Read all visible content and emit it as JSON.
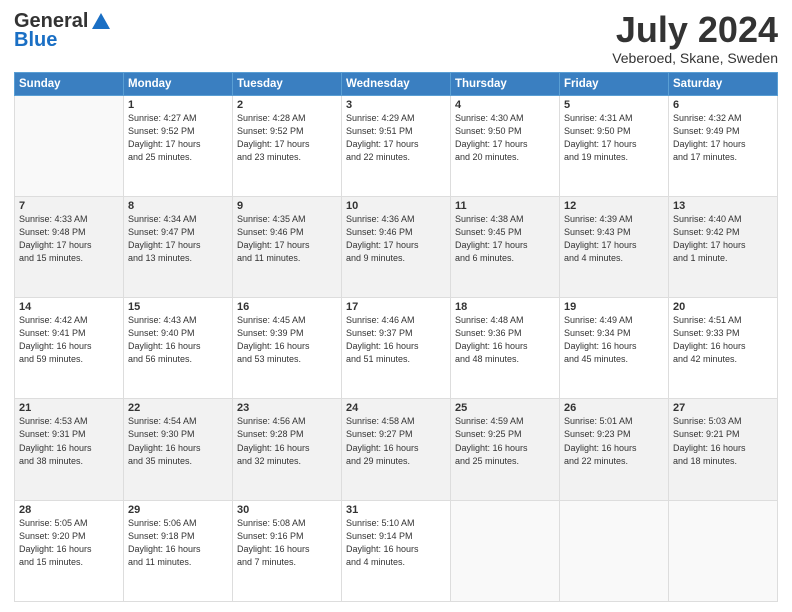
{
  "header": {
    "logo_general": "General",
    "logo_blue": "Blue",
    "month_title": "July 2024",
    "location": "Veberoed, Skane, Sweden"
  },
  "days_of_week": [
    "Sunday",
    "Monday",
    "Tuesday",
    "Wednesday",
    "Thursday",
    "Friday",
    "Saturday"
  ],
  "weeks": [
    [
      {
        "day": "",
        "info": ""
      },
      {
        "day": "1",
        "info": "Sunrise: 4:27 AM\nSunset: 9:52 PM\nDaylight: 17 hours\nand 25 minutes."
      },
      {
        "day": "2",
        "info": "Sunrise: 4:28 AM\nSunset: 9:52 PM\nDaylight: 17 hours\nand 23 minutes."
      },
      {
        "day": "3",
        "info": "Sunrise: 4:29 AM\nSunset: 9:51 PM\nDaylight: 17 hours\nand 22 minutes."
      },
      {
        "day": "4",
        "info": "Sunrise: 4:30 AM\nSunset: 9:50 PM\nDaylight: 17 hours\nand 20 minutes."
      },
      {
        "day": "5",
        "info": "Sunrise: 4:31 AM\nSunset: 9:50 PM\nDaylight: 17 hours\nand 19 minutes."
      },
      {
        "day": "6",
        "info": "Sunrise: 4:32 AM\nSunset: 9:49 PM\nDaylight: 17 hours\nand 17 minutes."
      }
    ],
    [
      {
        "day": "7",
        "info": "Sunrise: 4:33 AM\nSunset: 9:48 PM\nDaylight: 17 hours\nand 15 minutes."
      },
      {
        "day": "8",
        "info": "Sunrise: 4:34 AM\nSunset: 9:47 PM\nDaylight: 17 hours\nand 13 minutes."
      },
      {
        "day": "9",
        "info": "Sunrise: 4:35 AM\nSunset: 9:46 PM\nDaylight: 17 hours\nand 11 minutes."
      },
      {
        "day": "10",
        "info": "Sunrise: 4:36 AM\nSunset: 9:46 PM\nDaylight: 17 hours\nand 9 minutes."
      },
      {
        "day": "11",
        "info": "Sunrise: 4:38 AM\nSunset: 9:45 PM\nDaylight: 17 hours\nand 6 minutes."
      },
      {
        "day": "12",
        "info": "Sunrise: 4:39 AM\nSunset: 9:43 PM\nDaylight: 17 hours\nand 4 minutes."
      },
      {
        "day": "13",
        "info": "Sunrise: 4:40 AM\nSunset: 9:42 PM\nDaylight: 17 hours\nand 1 minute."
      }
    ],
    [
      {
        "day": "14",
        "info": "Sunrise: 4:42 AM\nSunset: 9:41 PM\nDaylight: 16 hours\nand 59 minutes."
      },
      {
        "day": "15",
        "info": "Sunrise: 4:43 AM\nSunset: 9:40 PM\nDaylight: 16 hours\nand 56 minutes."
      },
      {
        "day": "16",
        "info": "Sunrise: 4:45 AM\nSunset: 9:39 PM\nDaylight: 16 hours\nand 53 minutes."
      },
      {
        "day": "17",
        "info": "Sunrise: 4:46 AM\nSunset: 9:37 PM\nDaylight: 16 hours\nand 51 minutes."
      },
      {
        "day": "18",
        "info": "Sunrise: 4:48 AM\nSunset: 9:36 PM\nDaylight: 16 hours\nand 48 minutes."
      },
      {
        "day": "19",
        "info": "Sunrise: 4:49 AM\nSunset: 9:34 PM\nDaylight: 16 hours\nand 45 minutes."
      },
      {
        "day": "20",
        "info": "Sunrise: 4:51 AM\nSunset: 9:33 PM\nDaylight: 16 hours\nand 42 minutes."
      }
    ],
    [
      {
        "day": "21",
        "info": "Sunrise: 4:53 AM\nSunset: 9:31 PM\nDaylight: 16 hours\nand 38 minutes."
      },
      {
        "day": "22",
        "info": "Sunrise: 4:54 AM\nSunset: 9:30 PM\nDaylight: 16 hours\nand 35 minutes."
      },
      {
        "day": "23",
        "info": "Sunrise: 4:56 AM\nSunset: 9:28 PM\nDaylight: 16 hours\nand 32 minutes."
      },
      {
        "day": "24",
        "info": "Sunrise: 4:58 AM\nSunset: 9:27 PM\nDaylight: 16 hours\nand 29 minutes."
      },
      {
        "day": "25",
        "info": "Sunrise: 4:59 AM\nSunset: 9:25 PM\nDaylight: 16 hours\nand 25 minutes."
      },
      {
        "day": "26",
        "info": "Sunrise: 5:01 AM\nSunset: 9:23 PM\nDaylight: 16 hours\nand 22 minutes."
      },
      {
        "day": "27",
        "info": "Sunrise: 5:03 AM\nSunset: 9:21 PM\nDaylight: 16 hours\nand 18 minutes."
      }
    ],
    [
      {
        "day": "28",
        "info": "Sunrise: 5:05 AM\nSunset: 9:20 PM\nDaylight: 16 hours\nand 15 minutes."
      },
      {
        "day": "29",
        "info": "Sunrise: 5:06 AM\nSunset: 9:18 PM\nDaylight: 16 hours\nand 11 minutes."
      },
      {
        "day": "30",
        "info": "Sunrise: 5:08 AM\nSunset: 9:16 PM\nDaylight: 16 hours\nand 7 minutes."
      },
      {
        "day": "31",
        "info": "Sunrise: 5:10 AM\nSunset: 9:14 PM\nDaylight: 16 hours\nand 4 minutes."
      },
      {
        "day": "",
        "info": ""
      },
      {
        "day": "",
        "info": ""
      },
      {
        "day": "",
        "info": ""
      }
    ]
  ]
}
